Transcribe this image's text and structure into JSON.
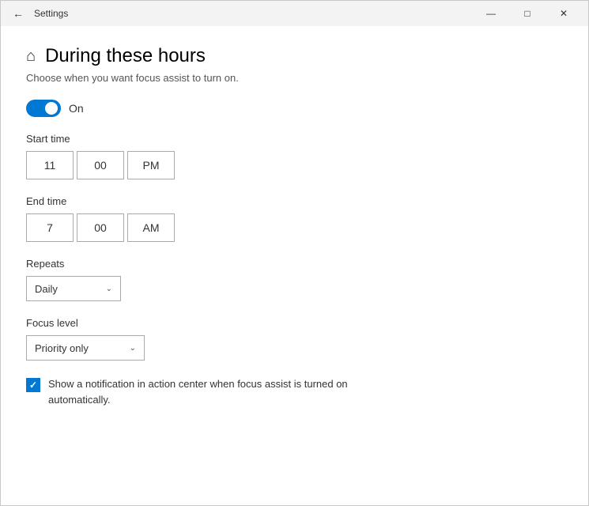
{
  "titlebar": {
    "title": "Settings",
    "minimize_label": "—",
    "maximize_label": "□",
    "close_label": "✕"
  },
  "page": {
    "title": "During these hours",
    "subtitle": "Choose when you want focus assist to turn on.",
    "toggle_state": "On",
    "start_time_label": "Start time",
    "start_hour": "11",
    "start_minute": "00",
    "start_period": "PM",
    "end_time_label": "End time",
    "end_hour": "7",
    "end_minute": "00",
    "end_period": "AM",
    "repeats_label": "Repeats",
    "repeats_value": "Daily",
    "focus_level_label": "Focus level",
    "focus_level_value": "Priority only",
    "checkbox_text": "Show a notification in action center when focus assist is turned on automatically."
  }
}
